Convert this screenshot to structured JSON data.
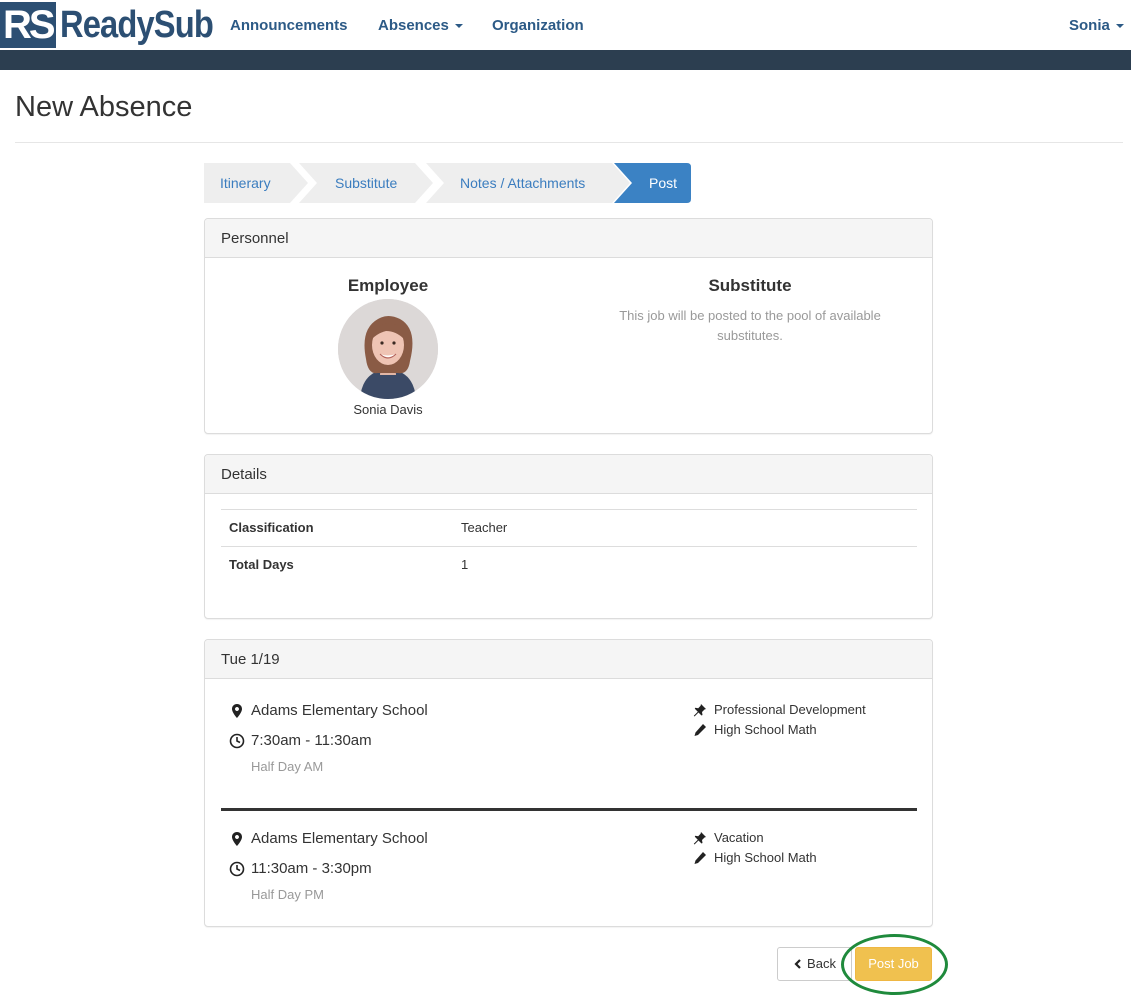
{
  "brand": {
    "logo_rs": "RS",
    "logo_text": "ReadySub",
    "color": "#2c4f73"
  },
  "nav": {
    "items": [
      {
        "label": "Announcements"
      },
      {
        "label": "Absences",
        "dropdown": true
      },
      {
        "label": "Organization"
      }
    ],
    "user": "Sonia"
  },
  "page": {
    "title": "New Absence"
  },
  "wizard": {
    "steps": [
      "Itinerary",
      "Substitute",
      "Notes / Attachments",
      "Post"
    ],
    "active_step": "Post"
  },
  "personnel": {
    "heading": "Personnel",
    "employee_title": "Employee",
    "employee_name": "Sonia Davis",
    "substitute_title": "Substitute",
    "substitute_desc": "This job will be posted to the pool of available substitutes."
  },
  "details": {
    "heading": "Details",
    "rows": [
      {
        "label": "Classification",
        "value": "Teacher"
      },
      {
        "label": "Total Days",
        "value": "1"
      }
    ]
  },
  "day": {
    "heading": "Tue 1/19",
    "entries": [
      {
        "location": "Adams Elementary School",
        "time": "7:30am - 11:30am",
        "duration": "Half Day AM",
        "reason": "Professional Development",
        "subject": "High School Math"
      },
      {
        "location": "Adams Elementary School",
        "time": "11:30am - 3:30pm",
        "duration": "Half Day PM",
        "reason": "Vacation",
        "subject": "High School Math"
      }
    ]
  },
  "actions": {
    "back": "Back",
    "post": "Post Job"
  },
  "colors": {
    "accent": "#3b82c4",
    "post_button": "#f0c14f",
    "highlight": "#1f8a3c",
    "nav_strip": "#2c3e50"
  }
}
